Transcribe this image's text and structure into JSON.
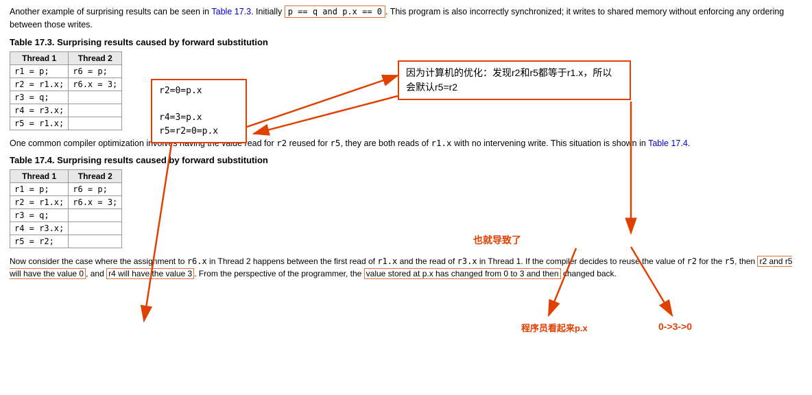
{
  "intro": {
    "text_before": "Another example of surprising results can be seen in ",
    "link": "Table 17.3",
    "text_after": ". Initially ",
    "code": "p == q and p.x == 0",
    "text_end": ". This program is also incorrectly synchronized; it writes to shared memory without enforcing any ordering between those writes."
  },
  "table1": {
    "title": "Table 17.3. Surprising results caused by forward substitution",
    "headers": [
      "Thread 1",
      "Thread 2"
    ],
    "rows": [
      [
        "r1 = p;",
        "r6 = p;"
      ],
      [
        "r2 = r1.x;",
        "r6.x = 3;"
      ],
      [
        "r3 = q;",
        ""
      ],
      [
        "r4 = r3.x;",
        ""
      ],
      [
        "r5 = r1.x;",
        ""
      ]
    ]
  },
  "annotation1": {
    "text": "r2=0=p.x\n\nr4=3=p.x\nr5=r2=0=p.x"
  },
  "annotation2": {
    "text": "因为计算机的优化：发现r2和r5都等于r1.x，所以\n会默认r5=r2"
  },
  "middle_text": {
    "text_before": "One common compiler optimization involves having the value read for ",
    "code1": "r2",
    "text_mid1": " reused for ",
    "code2": "r5",
    "text_mid2": ", they are both reads of ",
    "code3": "r1.x",
    "text_mid3": " with no intervening write. This situation is shown in ",
    "link": "Table 17.4",
    "text_end": "."
  },
  "table2": {
    "title": "Table 17.4. Surprising results caused by forward substitution",
    "headers": [
      "Thread 1",
      "Thread 2"
    ],
    "rows": [
      [
        "r1 = p;",
        "r6 = p;"
      ],
      [
        "r2 = r1.x;",
        "r6.x = 3;"
      ],
      [
        "r3 = q;",
        ""
      ],
      [
        "r4 = r3.x;",
        ""
      ],
      [
        "r5 = r2;",
        ""
      ]
    ]
  },
  "annotation3": {
    "text": "也就导致了"
  },
  "annotation4": {
    "text": "程序员看起来p.x"
  },
  "annotation5": {
    "text": "0->3->0"
  },
  "bottom": {
    "text1": "Now consider the case where the assignment to ",
    "code1": "r6.x",
    "text2": " in Thread 2 happens between the first read of ",
    "code2": "r1.x",
    "text3": " and the read of ",
    "code3": "r3.x",
    "text4": " in Thread 1. If the compiler decides to reuse the value of ",
    "code4": "r2",
    "text5": " for the ",
    "code5": "r5",
    "text6": ", then ",
    "highlight1": "r2 and r5 will have the value 0",
    "text7": ", and ",
    "highlight2": "r4 will have the value 3",
    "text8": ". From the perspective of the programmer, the ",
    "highlight3": "value stored at p.x has changed from 0 to 3 and then",
    "text9": " changed back."
  },
  "colors": {
    "orange_red": "#e04000",
    "link_blue": "#0000cc"
  }
}
